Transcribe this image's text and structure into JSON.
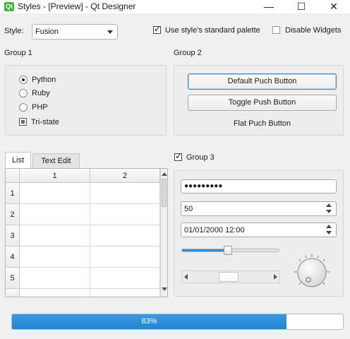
{
  "window": {
    "title": "Styles - [Preview] - Qt Designer",
    "app_icon_text": "Qt",
    "minimize_glyph": "—",
    "maximize_glyph": "☐",
    "close_glyph": "✕"
  },
  "toolbar": {
    "style_label": "Style:",
    "style_value": "Fusion",
    "standard_palette_label": "Use style's standard palette",
    "standard_palette_checked": true,
    "disable_widgets_label": "Disable Widgets",
    "disable_widgets_checked": false
  },
  "group1": {
    "title": "Group 1",
    "radios": [
      {
        "label": "Python",
        "checked": true
      },
      {
        "label": "Ruby",
        "checked": false
      },
      {
        "label": "PHP",
        "checked": false
      }
    ],
    "tristate_label": "Tri-state"
  },
  "group2": {
    "title": "Group 2",
    "default_button": "Default Puch Button",
    "toggle_button": "Toggle Push Button",
    "flat_button": "Flat Puch Button"
  },
  "tabs": {
    "items": [
      "List",
      "Text Edit"
    ],
    "active": "List"
  },
  "table": {
    "columns": [
      "1",
      "2"
    ],
    "rows": [
      "1",
      "2",
      "3",
      "4",
      "5"
    ]
  },
  "group3": {
    "title": "Group 3",
    "checked": true,
    "password_value": "●●●●●●●●●",
    "spin_value": "50",
    "datetime_value": "01/01/2000 12:00",
    "slider_value_pct": 47
  },
  "progress": {
    "text": "83%",
    "value_pct": 83
  },
  "colors": {
    "accent": "#2f8fdb",
    "progress_fill": "#2f8fdb",
    "title_bar": "#ffffff",
    "background": "#f0f0f0"
  }
}
